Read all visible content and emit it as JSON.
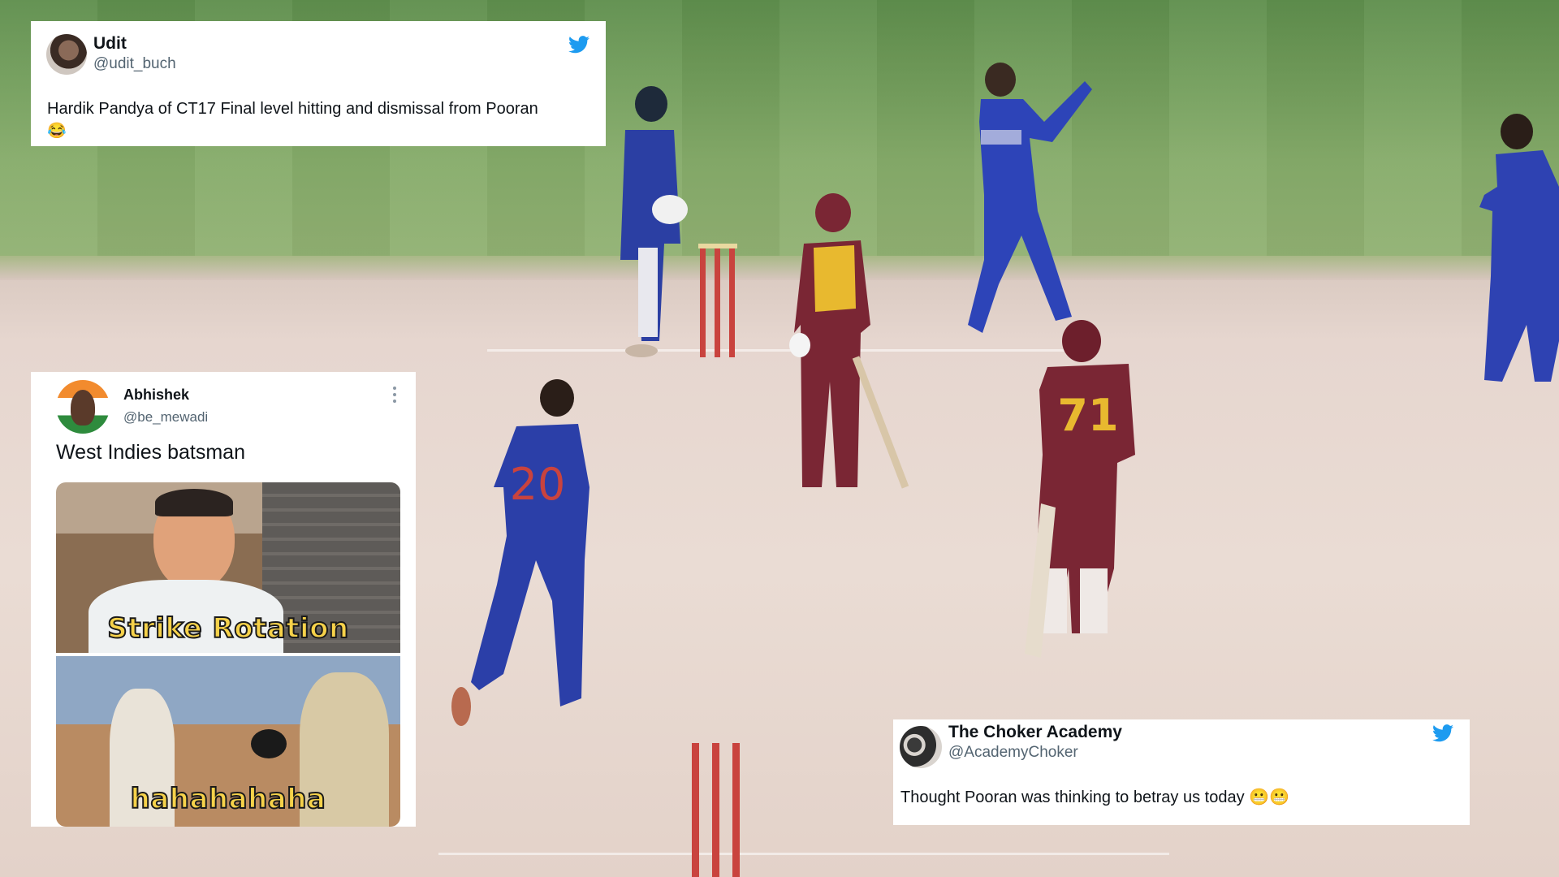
{
  "scene": {
    "description_icon": "cricket-pitch-photo",
    "players": [
      {
        "jersey_number": "20"
      },
      {
        "jersey_number": "71"
      }
    ]
  },
  "tweets": [
    {
      "name": "Udit",
      "handle": "@udit_buch",
      "text_line1": "Hardik Pandya of CT17 Final level hitting and dismissal from Pooran",
      "text_line2": "😂",
      "icon": "twitter-bird-icon"
    },
    {
      "name": "Abhishek",
      "handle": "@be_mewadi",
      "text": "West Indies batsman",
      "menu_icon": "more-vertical-icon",
      "meme_top_caption": "Strike Rotation",
      "meme_bottom_caption": "hahahahaha"
    },
    {
      "name": "The Choker Academy",
      "handle": "@AcademyChoker",
      "text": "Thought Pooran was thinking to betray us today 😬😬",
      "icon": "twitter-bird-icon"
    }
  ],
  "colors": {
    "twitter_blue": "#1d9bf0",
    "india_blue": "#2a3fa8",
    "windies_maroon": "#7a2634",
    "windies_yellow": "#e8b92f"
  }
}
